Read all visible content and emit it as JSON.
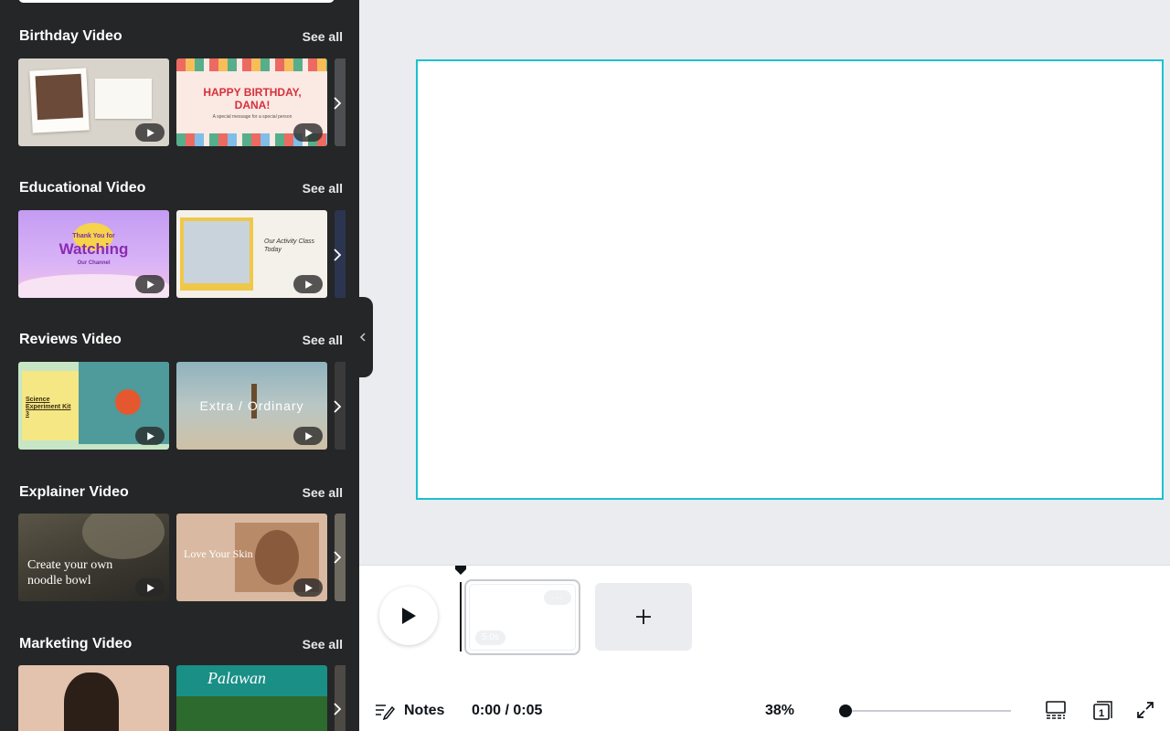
{
  "sidebar": {
    "sections": [
      {
        "title": "Birthday Video",
        "see_all": "See all"
      },
      {
        "title": "Educational Video",
        "see_all": "See all"
      },
      {
        "title": "Reviews Video",
        "see_all": "See all"
      },
      {
        "title": "Explainer Video",
        "see_all": "See all"
      },
      {
        "title": "Marketing Video",
        "see_all": "See all"
      }
    ],
    "thumb_text": {
      "happy_birthday": "HAPPY BIRTHDAY, DANA!",
      "happy_birthday_sub": "A special message for a special person",
      "thank_you": "Thank You for",
      "watching": "Watching",
      "our_channel": "Our Channel",
      "activity": "Our Activity Class Today",
      "science": "Science Experiment Kit 3",
      "extra_ordinary": "Extra / Ordinary",
      "noodle": "Create your own noodle bowl",
      "love_skin": "Love Your Skin",
      "palawan": "Palawan"
    }
  },
  "timeline": {
    "clip_duration": "5.0s",
    "notes_label": "Notes",
    "time_readout": "0:00 / 0:05",
    "zoom_value": "38%",
    "zoom_level_fraction": 0.02,
    "page_count": "1"
  },
  "colors": {
    "sidebar_bg": "#252627",
    "canvas_selection": "#19c2d0",
    "workspace_bg": "#ebecf0"
  },
  "icons": [
    "play-icon",
    "chevron-right-icon",
    "chevron-left-icon",
    "plus-icon",
    "notes-icon",
    "grid-view-icon",
    "page-count-icon",
    "fullscreen-icon"
  ]
}
